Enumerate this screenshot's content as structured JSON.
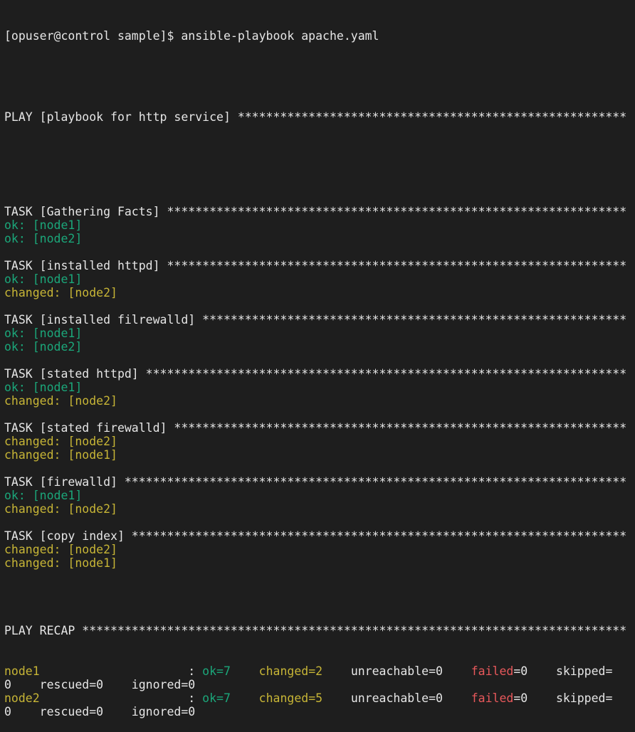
{
  "terminal": {
    "prompt": "[opuser@control sample]$ ansible-playbook apache.yaml",
    "play_header": "PLAY [playbook for http service] *******************************************************",
    "tasks": [
      {
        "header": "TASK [Gathering Facts] *****************************************************************",
        "results": [
          {
            "status": "ok",
            "text": "ok: [node1]"
          },
          {
            "status": "ok",
            "text": "ok: [node2]"
          }
        ]
      },
      {
        "header": "TASK [installed httpd] *****************************************************************",
        "results": [
          {
            "status": "ok",
            "text": "ok: [node1]"
          },
          {
            "status": "changed",
            "text": "changed: [node2]"
          }
        ]
      },
      {
        "header": "TASK [installed filrewalld] ************************************************************",
        "results": [
          {
            "status": "ok",
            "text": "ok: [node1]"
          },
          {
            "status": "ok",
            "text": "ok: [node2]"
          }
        ]
      },
      {
        "header": "TASK [stated httpd] ********************************************************************",
        "results": [
          {
            "status": "ok",
            "text": "ok: [node1]"
          },
          {
            "status": "changed",
            "text": "changed: [node2]"
          }
        ]
      },
      {
        "header": "TASK [stated firewalld] ****************************************************************",
        "results": [
          {
            "status": "changed",
            "text": "changed: [node2]"
          },
          {
            "status": "changed",
            "text": "changed: [node1]"
          }
        ]
      },
      {
        "header": "TASK [firewalld] ***********************************************************************",
        "results": [
          {
            "status": "ok",
            "text": "ok: [node1]"
          },
          {
            "status": "changed",
            "text": "changed: [node2]"
          }
        ]
      },
      {
        "header": "TASK [copy index] **********************************************************************",
        "results": [
          {
            "status": "changed",
            "text": "changed: [node2]"
          },
          {
            "status": "changed",
            "text": "changed: [node1]"
          }
        ]
      }
    ],
    "recap_header": "PLAY RECAP *****************************************************************************",
    "recap": [
      {
        "host": "node1",
        "sep": "                     : ",
        "ok": "ok=7",
        "gap1": "    ",
        "changed": "changed=2",
        "gap2": "    ",
        "unreachable": "unreachable=0",
        "gap3": "    ",
        "failed_label": "failed",
        "failed_value": "=0",
        "gap4": "    ",
        "skipped": "skipped=",
        "cont": "0    rescued=0    ignored=0"
      },
      {
        "host": "node2",
        "sep": "                     : ",
        "ok": "ok=7",
        "gap1": "    ",
        "changed": "changed=5",
        "gap2": "    ",
        "unreachable": "unreachable=0",
        "gap3": "    ",
        "failed_label": "failed",
        "failed_value": "=0",
        "gap4": "    ",
        "skipped": "skipped=",
        "cont": "0    rescued=0    ignored=0"
      }
    ],
    "colors": {
      "background": "#1e1e1e",
      "text": "#e6e6e6",
      "ok": "#1ba77a",
      "changed": "#c7b536",
      "failed": "#e8585b"
    }
  }
}
